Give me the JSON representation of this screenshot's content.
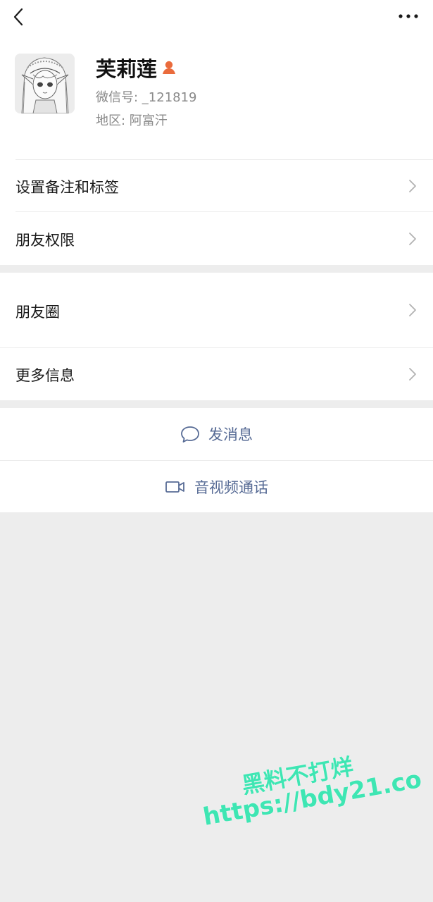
{
  "profile": {
    "name": "芙莉莲",
    "wechat_id": "微信号: _121819",
    "region": "地区: 阿富汗"
  },
  "menu": {
    "remark_tags": "设置备注和标签",
    "friend_permissions": "朋友权限",
    "moments": "朋友圈",
    "more_info": "更多信息"
  },
  "actions": {
    "send_message": "发消息",
    "av_call": "音视频通话"
  },
  "watermark": {
    "line1": "黑料不打烊",
    "line2": "https://bdy21.co"
  },
  "colors": {
    "link_blue": "#576b95",
    "badge_orange": "#ea6b3c",
    "watermark_green": "#3ee6b3",
    "background": "#ededed"
  }
}
